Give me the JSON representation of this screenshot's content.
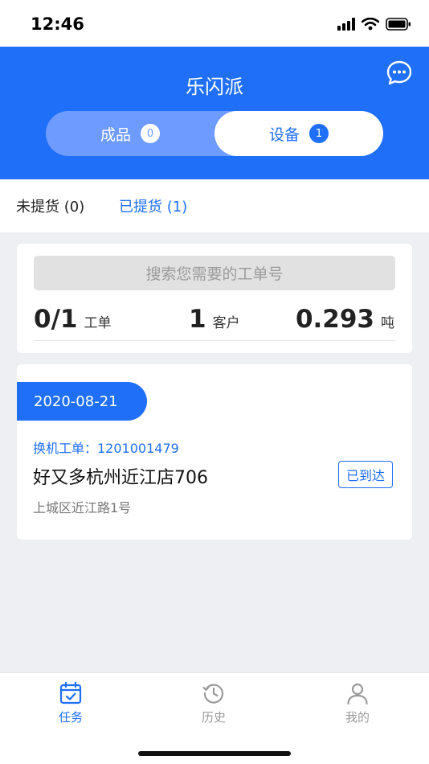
{
  "status_bar": {
    "time": "12:46"
  },
  "header": {
    "title": "乐闪派",
    "segments": [
      {
        "label": "成品",
        "count": "0"
      },
      {
        "label": "设备",
        "count": "1"
      }
    ]
  },
  "subtabs": {
    "unpicked": "未提货 (0)",
    "picked": "已提货 (1)"
  },
  "summary": {
    "search_placeholder": "搜索您需要的工单号",
    "orders_value": "0/1",
    "orders_unit": "工单",
    "customers_value": "1",
    "customers_unit": "客户",
    "tons_value": "0.293",
    "tons_unit": "吨"
  },
  "order": {
    "date": "2020-08-21",
    "order_no": "换机工单：1201001479",
    "store": "好又多杭州近江店706",
    "address": "上城区近江路1号",
    "status": "已到达"
  },
  "tabbar": {
    "task": "任务",
    "history": "历史",
    "me": "我的"
  },
  "colors": {
    "primary": "#1f6ff8",
    "segment_bg": "#6e9bff"
  },
  "icons": [
    "chat-bubble-icon",
    "calendar-check-icon",
    "history-icon",
    "user-icon"
  ]
}
